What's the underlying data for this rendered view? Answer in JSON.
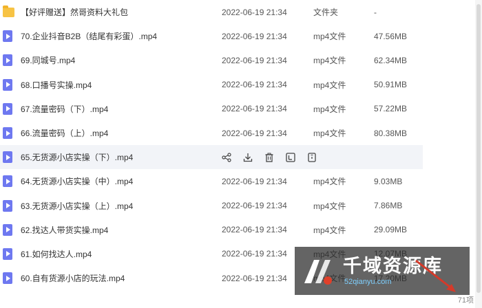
{
  "files": [
    {
      "name": "【好评赠送】然哥资料大礼包",
      "date": "2022-06-19 21:34",
      "type": "文件夹",
      "size": "-",
      "kind": "folder"
    },
    {
      "name": "70.企业抖音B2B（结尾有彩蛋）.mp4",
      "date": "2022-06-19 21:34",
      "type": "mp4文件",
      "size": "47.56MB",
      "kind": "video"
    },
    {
      "name": "69.同城号.mp4",
      "date": "2022-06-19 21:34",
      "type": "mp4文件",
      "size": "62.34MB",
      "kind": "video"
    },
    {
      "name": "68.口播号实操.mp4",
      "date": "2022-06-19 21:34",
      "type": "mp4文件",
      "size": "50.91MB",
      "kind": "video"
    },
    {
      "name": "67.流量密码（下）.mp4",
      "date": "2022-06-19 21:34",
      "type": "mp4文件",
      "size": "57.22MB",
      "kind": "video"
    },
    {
      "name": "66.流量密码（上）.mp4",
      "date": "2022-06-19 21:34",
      "type": "mp4文件",
      "size": "80.38MB",
      "kind": "video"
    },
    {
      "name": "65.无货源小店实操（下）.mp4",
      "date": "",
      "type": "",
      "size": "",
      "kind": "video",
      "hover": true
    },
    {
      "name": "64.无货源小店实操（中）.mp4",
      "date": "2022-06-19 21:34",
      "type": "mp4文件",
      "size": "9.03MB",
      "kind": "video"
    },
    {
      "name": "63.无货源小店实操（上）.mp4",
      "date": "2022-06-19 21:34",
      "type": "mp4文件",
      "size": "7.86MB",
      "kind": "video"
    },
    {
      "name": "62.找达人带货实操.mp4",
      "date": "2022-06-19 21:34",
      "type": "mp4文件",
      "size": "29.09MB",
      "kind": "video"
    },
    {
      "name": "61.如何找达人.mp4",
      "date": "2022-06-19 21:34",
      "type": "mp4文件",
      "size": "12.07MB",
      "kind": "video"
    },
    {
      "name": "60.自有货源小店的玩法.mp4",
      "date": "2022-06-19 21:34",
      "type": "mp4文件",
      "size": "17.20MB",
      "kind": "video"
    }
  ],
  "row_actions": [
    "share-icon",
    "download-icon",
    "delete-icon",
    "rename-icon",
    "more-icon"
  ],
  "footer": {
    "count": "71项"
  },
  "watermark": {
    "title": "千域资源库",
    "url": "52qianyu.com"
  },
  "colors": {
    "video_icon": "#6e78f0",
    "folder_icon": "#f7c344",
    "hover_row": "#f2f4f8"
  }
}
